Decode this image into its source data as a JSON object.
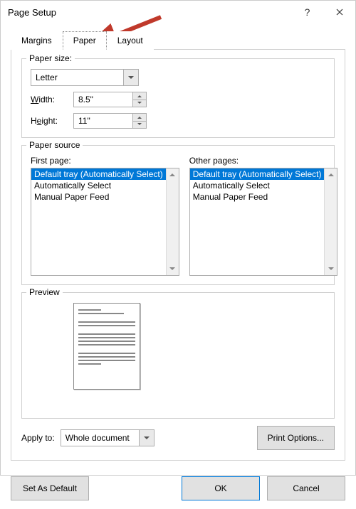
{
  "title": "Page Setup",
  "tabs": {
    "margins": "Margins",
    "paper": "Paper",
    "layout": "Layout",
    "active_index": 1
  },
  "paper_size": {
    "legend": "Paper size:",
    "size_value": "Letter",
    "width_label": "Width:",
    "width_value": "8.5\"",
    "height_label": "Height:",
    "height_value": "11\""
  },
  "paper_source": {
    "legend": "Paper source",
    "first_page_label": "First page:",
    "other_pages_label": "Other pages:",
    "first_page_items": [
      "Default tray (Automatically Select)",
      "Automatically Select",
      "Manual Paper Feed"
    ],
    "other_pages_items": [
      "Default tray (Automatically Select)",
      "Automatically Select",
      "Manual Paper Feed"
    ],
    "first_page_selected_index": 0,
    "other_pages_selected_index": 0
  },
  "preview_legend": "Preview",
  "apply_to": {
    "label": "Apply to:",
    "value": "Whole document"
  },
  "buttons": {
    "print_options": "Print Options...",
    "set_default": "Set As Default",
    "ok": "OK",
    "cancel": "Cancel"
  }
}
